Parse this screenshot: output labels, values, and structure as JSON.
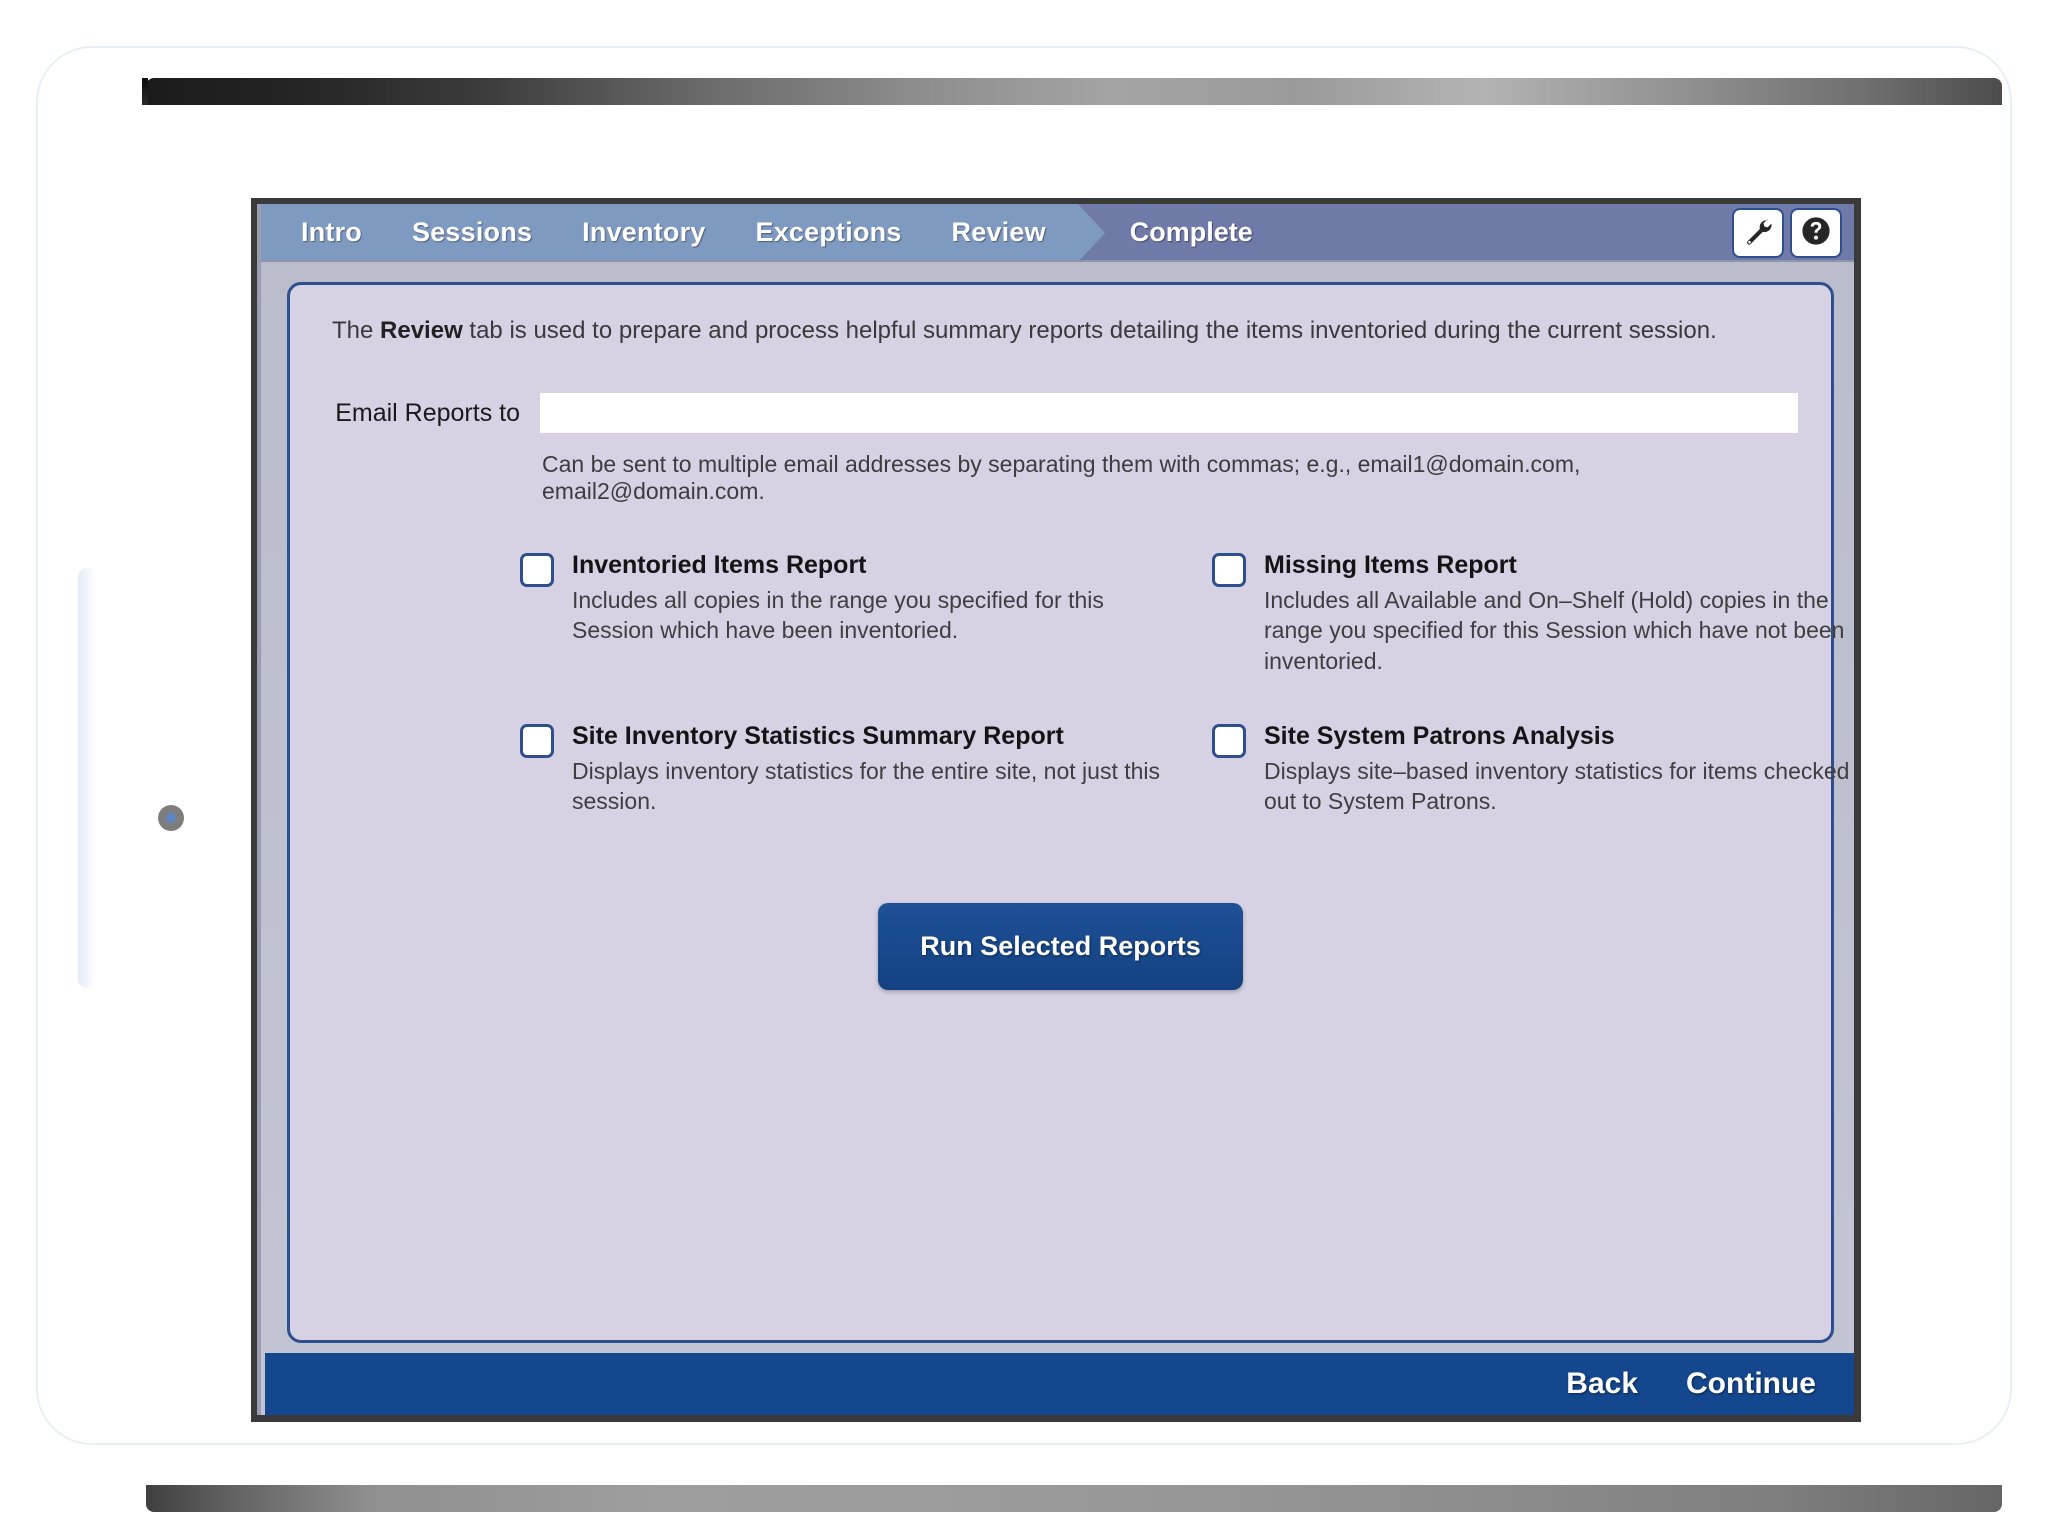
{
  "tabbar": {
    "tabs": [
      {
        "label": "Intro",
        "active": false
      },
      {
        "label": "Sessions",
        "active": false
      },
      {
        "label": "Inventory",
        "active": false
      },
      {
        "label": "Exceptions",
        "active": false
      },
      {
        "label": "Review",
        "active": true
      }
    ],
    "complete_label": "Complete",
    "tools_icon": "wrench-icon",
    "help_icon": "help-circle-icon",
    "active_color": "#7f9ac1",
    "inactive_color": "#6f7aa8"
  },
  "content": {
    "intro_prefix": "The ",
    "intro_bold": "Review",
    "intro_suffix": " tab is used to prepare and process helpful summary reports detailing the items inventoried during the current session."
  },
  "email": {
    "label": "Email Reports to",
    "value": "",
    "placeholder": "",
    "hint": "Can be sent to multiple email addresses by separating them with commas; e.g., email1@domain.com, email2@domain.com."
  },
  "reports": [
    {
      "title": "Inventoried Items Report",
      "desc": "Includes all copies in the range you specified for this Session which have been inventoried.",
      "checked": false
    },
    {
      "title": "Missing Items Report",
      "desc": "Includes all Available and On–Shelf (Hold) copies in the range you specified for this Session which have not been inventoried.",
      "checked": false
    },
    {
      "title": "Site Inventory Statistics Summary Report",
      "desc": "Displays inventory statistics for the entire site, not just this session.",
      "checked": false
    },
    {
      "title": "Site System Patrons Analysis",
      "desc": "Displays site–based inventory statistics for items checked out to System Patrons.",
      "checked": false
    }
  ],
  "actions": {
    "run_label": "Run Selected Reports",
    "run_color": "#1a4d8f"
  },
  "footer": {
    "back_label": "Back",
    "continue_label": "Continue",
    "bar_color": "#14478e"
  }
}
